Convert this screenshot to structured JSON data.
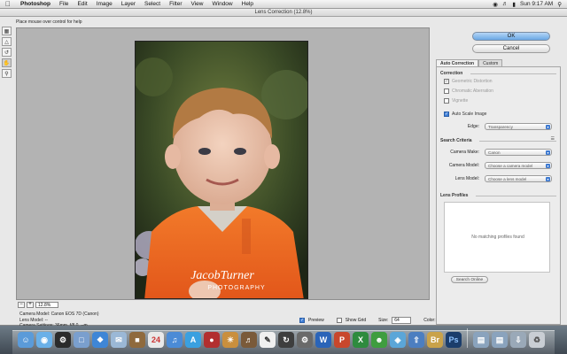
{
  "menubar": {
    "apple": "",
    "items": [
      "Photoshop",
      "File",
      "Edit",
      "Image",
      "Layer",
      "Select",
      "Filter",
      "View",
      "Window",
      "Help"
    ],
    "clock": "Sun 9:17 AM"
  },
  "dialog": {
    "title": "Lens Correction (12.8%)",
    "hint": "Place mouse over control for help",
    "zoom_value": "12.8%",
    "camera_info": [
      "Camera Model: Canon EOS 7D (Canon)",
      "Lens Model: --",
      "Camera Settings: 36mm, f/8.0, --m"
    ],
    "preview_label": "Preview",
    "show_grid_label": "Show Grid",
    "size_label": "Size:",
    "size_value": "64",
    "color_label": "Color:",
    "watermark_line1": "JacobTurner",
    "watermark_line2": "PHOTOGRAPHY"
  },
  "buttons": {
    "ok": "OK",
    "cancel": "Cancel"
  },
  "panel": {
    "tabs": [
      "Auto Correction",
      "Custom"
    ],
    "correction_title": "Correction",
    "geometric": "Geometric Distortion",
    "chromatic": "Chromatic Aberration",
    "vignette": "Vignette",
    "auto_scale": "Auto Scale Image",
    "edge_label": "Edge:",
    "edge_value": "Transparency",
    "search_title": "Search Criteria",
    "camera_make_label": "Camera Make:",
    "camera_make_value": "Canon",
    "camera_model_label": "Camera Model:",
    "camera_model_value": "Choose a camera model",
    "lens_model_label": "Lens Model:",
    "lens_model_value": "Choose a lens model",
    "profiles_title": "Lens Profiles",
    "no_profiles": "No matching profiles found",
    "search_online": "Search Online"
  },
  "colors": {
    "ok_button": "#6aa7e4",
    "shirt": "#ef6a1e",
    "canvas_bg": "#b3b3b3"
  }
}
